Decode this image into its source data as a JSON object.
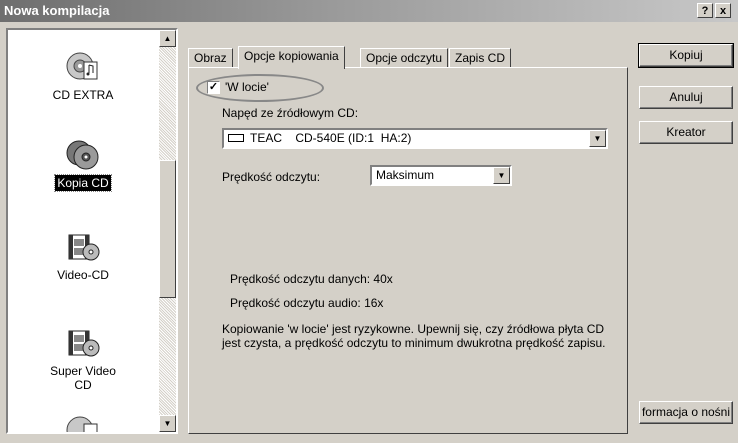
{
  "window": {
    "title": "Nowa kompilacja",
    "help": "?",
    "close": "x"
  },
  "left_list": {
    "items": [
      {
        "label": "CD EXTRA",
        "icon": "cd-extra-icon",
        "selected": false
      },
      {
        "label": "Kopia CD",
        "icon": "cd-copy-icon",
        "selected": true
      },
      {
        "label": "Video-CD",
        "icon": "video-cd-icon",
        "selected": false
      },
      {
        "label": "Super Video CD",
        "icon": "super-video-cd-icon",
        "selected": false
      }
    ]
  },
  "tabs": [
    "Obraz",
    "Opcje kopiowania",
    "Opcje odczytu",
    "Zapis CD"
  ],
  "active_tab": "Opcje kopiowania",
  "options": {
    "on_the_fly_label": "'W locie'",
    "on_the_fly_checked": true,
    "source_drive_label": "Napęd ze źródłowym CD:",
    "source_drive_value": "TEAC    CD-540E (ID:1  HA:2)",
    "read_speed_label": "Prędkość odczytu:",
    "read_speed_value": "Maksimum",
    "data_speed": "Prędkość odczytu danych: 40x",
    "audio_speed": "Prędkość odczytu audio: 16x",
    "warning": "Kopiowanie 'w locie' jest ryzykowne. Upewnij się, czy źródłowa płyta CD jest czysta, a prędkość odczytu to minimum dwukrotna prędkość zapisu."
  },
  "buttons": {
    "copy": "Kopiuj",
    "cancel": "Anuluj",
    "wizard": "Kreator",
    "media_info": "formacja o nośni"
  }
}
